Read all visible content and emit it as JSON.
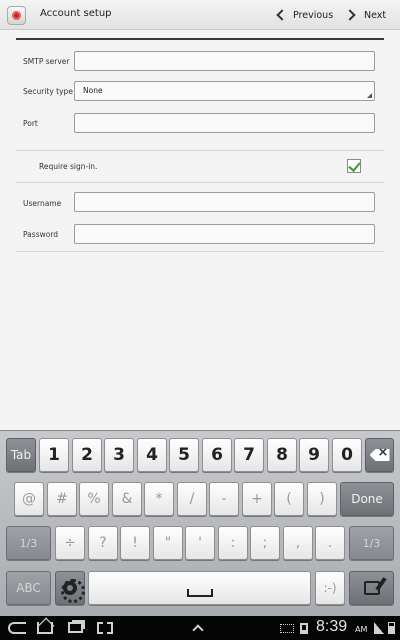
{
  "header": {
    "title": "Account setup",
    "previous_label": "Previous",
    "next_label": "Next"
  },
  "form": {
    "smtp_label": "SMTP server",
    "smtp_value": "",
    "security_label": "Security type",
    "security_value": "None",
    "port_label": "Port",
    "port_value": "",
    "require_signin_label": "Require sign-in.",
    "require_signin_checked": true,
    "username_label": "Username",
    "username_value": "",
    "password_label": "Password",
    "password_value": ""
  },
  "keyboard": {
    "tab": "Tab",
    "digits": [
      "1",
      "2",
      "3",
      "4",
      "5",
      "6",
      "7",
      "8",
      "9",
      "0"
    ],
    "symbols_row2": [
      "@",
      "#",
      "%",
      "&",
      "*",
      "/",
      "-",
      "+",
      "(",
      ")"
    ],
    "done": "Done",
    "page_left": "1/3",
    "symbols_row3": [
      "÷",
      "?",
      "!",
      "\"",
      "'",
      ":",
      ";",
      ",",
      "."
    ],
    "page_right": "1/3",
    "abc": "ABC",
    "smiley": ":-)"
  },
  "status_bar": {
    "time": "8:39",
    "ampm": "AM"
  },
  "colors": {
    "accent_check": "#3a9a2a",
    "header_bg": "#e8e8e8",
    "keyboard_bg": "#b8babd"
  }
}
